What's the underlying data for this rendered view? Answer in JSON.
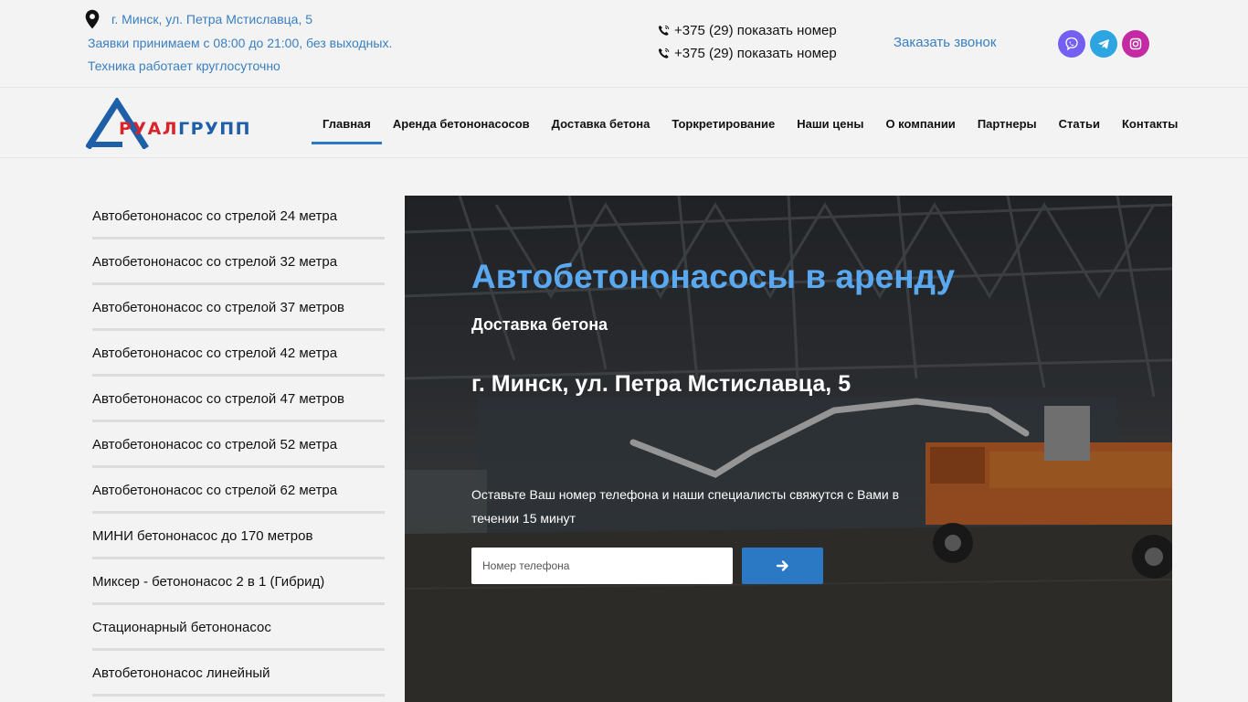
{
  "topbar": {
    "address": "г. Минск, ул. Петра Мстиславца, 5",
    "hours": "Заявки принимаем с 08:00 до 21:00, без выходных.",
    "works": "Техника работает круглосуточно",
    "phones": [
      "+375 (29) показать номер",
      "+375 (29) показать номер"
    ],
    "callback": "Заказать звонок",
    "social": [
      "viber-icon",
      "telegram-icon",
      "instagram-icon"
    ]
  },
  "logo": {
    "part1": "РУАЛ",
    "part2": "ГРУПП"
  },
  "nav": {
    "items": [
      "Главная",
      "Аренда бетононасосов",
      "Доставка бетона",
      "Торкретирование",
      "Наши цены",
      "О компании",
      "Партнеры",
      "Статьи",
      "Контакты"
    ],
    "active": "Главная"
  },
  "sidebar": {
    "items": [
      "Автобетононасос со стрелой 24 метра",
      "Автобетононасос со стрелой 32 метра",
      "Автобетононасос со стрелой 37 метров",
      "Автобетононасос со стрелой 42 метра",
      "Автобетононасос со стрелой 47 метров",
      "Автобетононасос со стрелой 52 метра",
      "Автобетононасос со стрелой 62 метра",
      "МИНИ бетононасос до 170 метров",
      "Миксер - бетононасос 2 в 1 (Гибрид)",
      "Стационарный бетононасос",
      "Автобетононасос линейный"
    ]
  },
  "hero": {
    "title": "Автобетононасосы в аренду",
    "subtitle": "Доставка бетона",
    "address": "г. Минск, ул. Петра Мстиславца, 5",
    "text": "Оставьте Ваш номер телефона и наши специалисты свяжутся с Вами в течении 15 минут",
    "input_placeholder": "Номер телефона"
  },
  "colors": {
    "accent": "#2b78c5",
    "link": "#3a7fc1",
    "title": "#5aa9f0"
  }
}
